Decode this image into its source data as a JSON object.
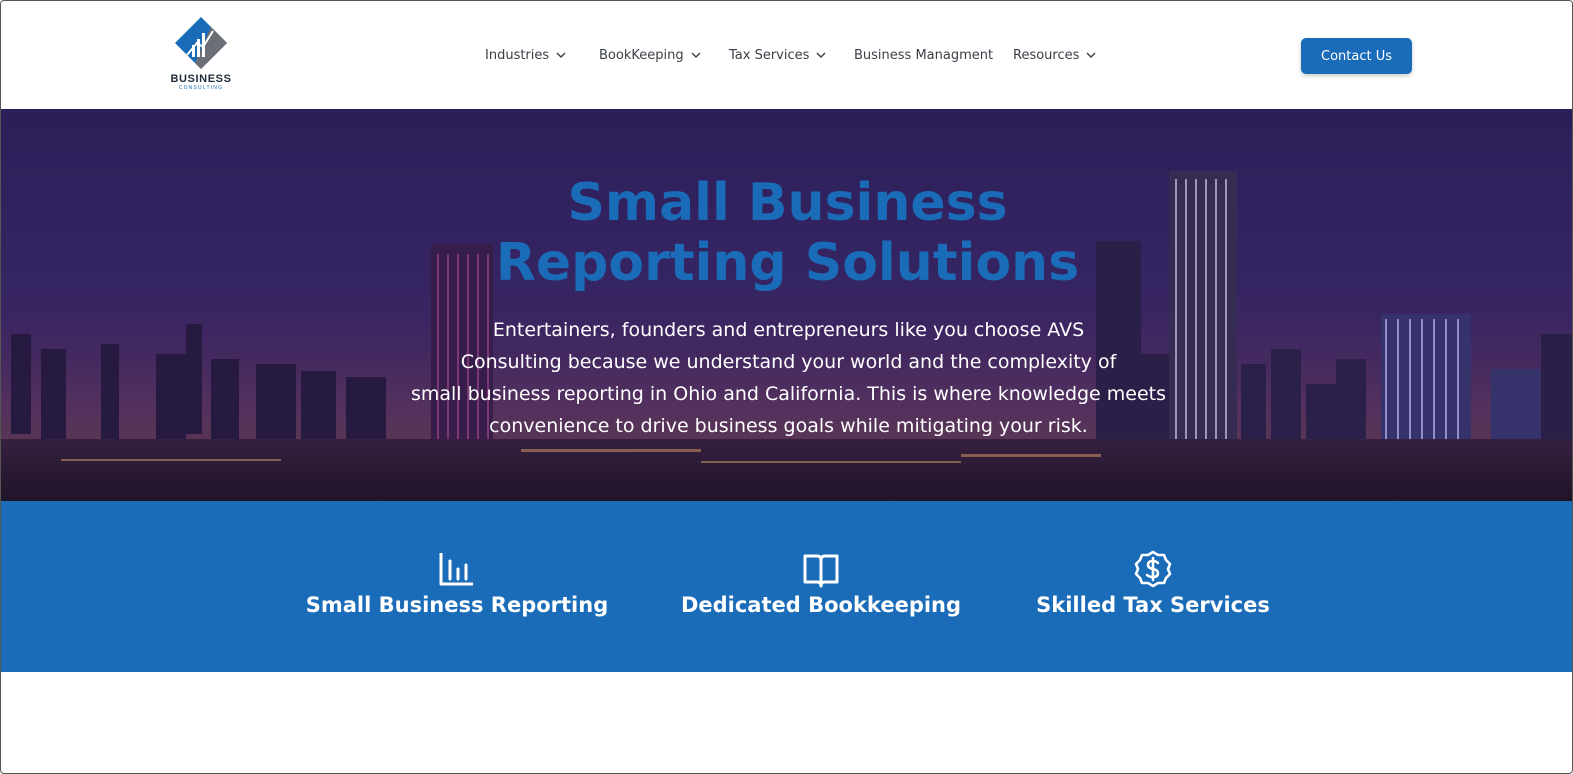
{
  "brand": {
    "name": "BUSINESS",
    "tagline": "CONSULTING",
    "logo_icon": "chart-diamond-logo",
    "color": "#1a6bb8"
  },
  "nav": {
    "items": [
      {
        "label": "Industries",
        "has_dropdown": true
      },
      {
        "label": "BookKeeping",
        "has_dropdown": true
      },
      {
        "label": "Tax Services",
        "has_dropdown": true
      },
      {
        "label": "Business Managment",
        "has_dropdown": false
      },
      {
        "label": "Resources",
        "has_dropdown": true
      }
    ],
    "contact_label": "Contact Us"
  },
  "hero": {
    "title_line1": "Small Business",
    "title_line2": "Reporting Solutions",
    "text_line1": "Entertainers, founders and entrepreneurs like you choose AVS",
    "text_line2": "Consulting because we understand your world and the complexity of",
    "text_line3": "small business reporting in Ohio and California. This is where knowledge meets",
    "text_line4": "convenience to drive business goals while mitigating your risk."
  },
  "features": [
    {
      "label": "Small Business Reporting",
      "icon": "bar-chart-icon"
    },
    {
      "label": "Dedicated Bookkeeping",
      "icon": "open-book-icon"
    },
    {
      "label": "Skilled Tax Services",
      "icon": "dollar-badge-icon"
    }
  ],
  "colors": {
    "primary": "#1a6bb8",
    "nav_text": "#3a3f47",
    "hero_overlay": "#3a2866"
  }
}
